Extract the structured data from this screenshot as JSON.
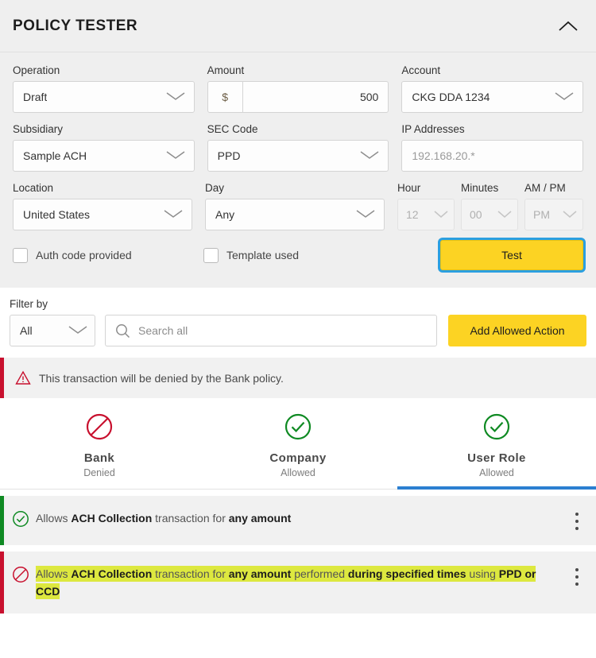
{
  "panel": {
    "title": "POLICY TESTER",
    "collapse_icon": "chevron-up-icon"
  },
  "form": {
    "operation": {
      "label": "Operation",
      "value": "Draft"
    },
    "amount": {
      "label": "Amount",
      "currency_symbol": "$",
      "value": "500"
    },
    "account": {
      "label": "Account",
      "value": "CKG DDA 1234"
    },
    "subsidiary": {
      "label": "Subsidiary",
      "value": "Sample ACH"
    },
    "sec_code": {
      "label": "SEC Code",
      "value": "PPD"
    },
    "ip_addresses": {
      "label": "IP Addresses",
      "placeholder": "192.168.20.*",
      "value": ""
    },
    "location": {
      "label": "Location",
      "value": "United States"
    },
    "day": {
      "label": "Day",
      "value": "Any"
    },
    "hour": {
      "label": "Hour",
      "value": "12"
    },
    "minutes": {
      "label": "Minutes",
      "value": "00"
    },
    "am_pm": {
      "label": "AM / PM",
      "value": "PM"
    },
    "auth_code_checkbox": {
      "label": "Auth code provided",
      "checked": false
    },
    "template_used_checkbox": {
      "label": "Template used",
      "checked": false
    },
    "test_button": {
      "label": "Test"
    }
  },
  "filter": {
    "label": "Filter by",
    "select_value": "All",
    "search_placeholder": "Search all",
    "search_value": "",
    "add_button": "Add Allowed Action"
  },
  "alert": {
    "icon": "warning-triangle-icon",
    "message": "This transaction will be denied by the Bank policy."
  },
  "tabs": [
    {
      "name": "Bank",
      "status": "Denied",
      "icon": "denied-circle-slash-icon",
      "active": false
    },
    {
      "name": "Company",
      "status": "Allowed",
      "icon": "check-circle-icon",
      "active": false
    },
    {
      "name": "User Role",
      "status": "Allowed",
      "icon": "check-circle-icon",
      "active": true
    }
  ],
  "results": [
    {
      "state": "allowed",
      "icon": "check-circle-icon",
      "highlighted": false,
      "parts": [
        {
          "text": "Allows ",
          "bold": false
        },
        {
          "text": "ACH Collection",
          "bold": true
        },
        {
          "text": " transaction for ",
          "bold": false
        },
        {
          "text": "any amount",
          "bold": true
        }
      ],
      "menu_icon": "kebab-menu-icon"
    },
    {
      "state": "denied",
      "icon": "denied-circle-slash-icon",
      "highlighted": true,
      "parts": [
        {
          "text": "Allows ",
          "bold": false
        },
        {
          "text": "ACH Collection",
          "bold": true
        },
        {
          "text": " transaction for ",
          "bold": false
        },
        {
          "text": "any amount",
          "bold": true
        },
        {
          "text": " performed ",
          "bold": false
        },
        {
          "text": "during specified times",
          "bold": true
        },
        {
          "text": " using ",
          "bold": false
        },
        {
          "text": "PPD or CCD",
          "bold": true
        }
      ],
      "menu_icon": "kebab-menu-icon"
    }
  ],
  "colors": {
    "accent_yellow": "#fcd323",
    "highlight": "#dde83f",
    "denied_red": "#c8102e",
    "allowed_green": "#0f8a23",
    "active_tab_blue": "#2b7fd1",
    "focus_blue": "#2b9fe0",
    "panel_grey": "#efefef"
  }
}
